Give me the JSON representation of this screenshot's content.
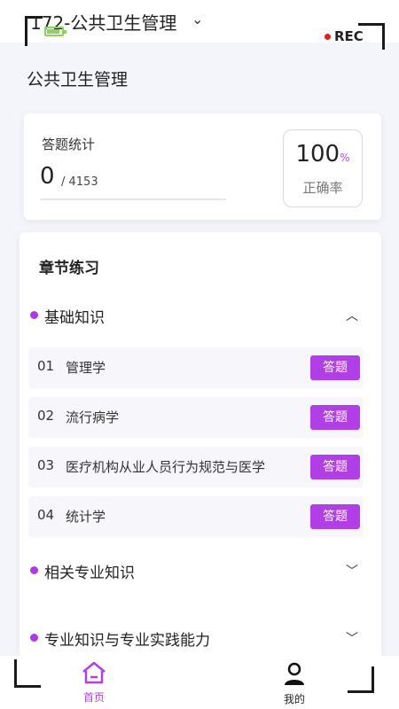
{
  "app_bar": {
    "title": "172-公共卫生管理",
    "rec_label": "REC"
  },
  "page_title": "公共卫生管理",
  "stats": {
    "label": "答题统计",
    "answered": "0",
    "total": "/ 4153",
    "rate_value": "100",
    "rate_unit": "%",
    "rate_label": "正确率"
  },
  "chapters": {
    "section_title": "章节练习",
    "groups": [
      {
        "label": "基础知识",
        "expanded": true,
        "items": [
          {
            "num": "01",
            "name": "管理学",
            "button": "答题"
          },
          {
            "num": "02",
            "name": "流行病学",
            "button": "答题"
          },
          {
            "num": "03",
            "name": "医疗机构从业人员行为规范与医学",
            "button": "答题"
          },
          {
            "num": "04",
            "name": "统计学",
            "button": "答题"
          }
        ]
      },
      {
        "label": "相关专业知识",
        "expanded": false
      },
      {
        "label": "专业知识与专业实践能力",
        "expanded": false
      }
    ]
  },
  "bottom_nav": {
    "home_label": "首页",
    "mine_label": "我的"
  },
  "colors": {
    "accent": "#b23fe6",
    "rec_dot": "#e02020",
    "battery": "#8bd35a"
  }
}
